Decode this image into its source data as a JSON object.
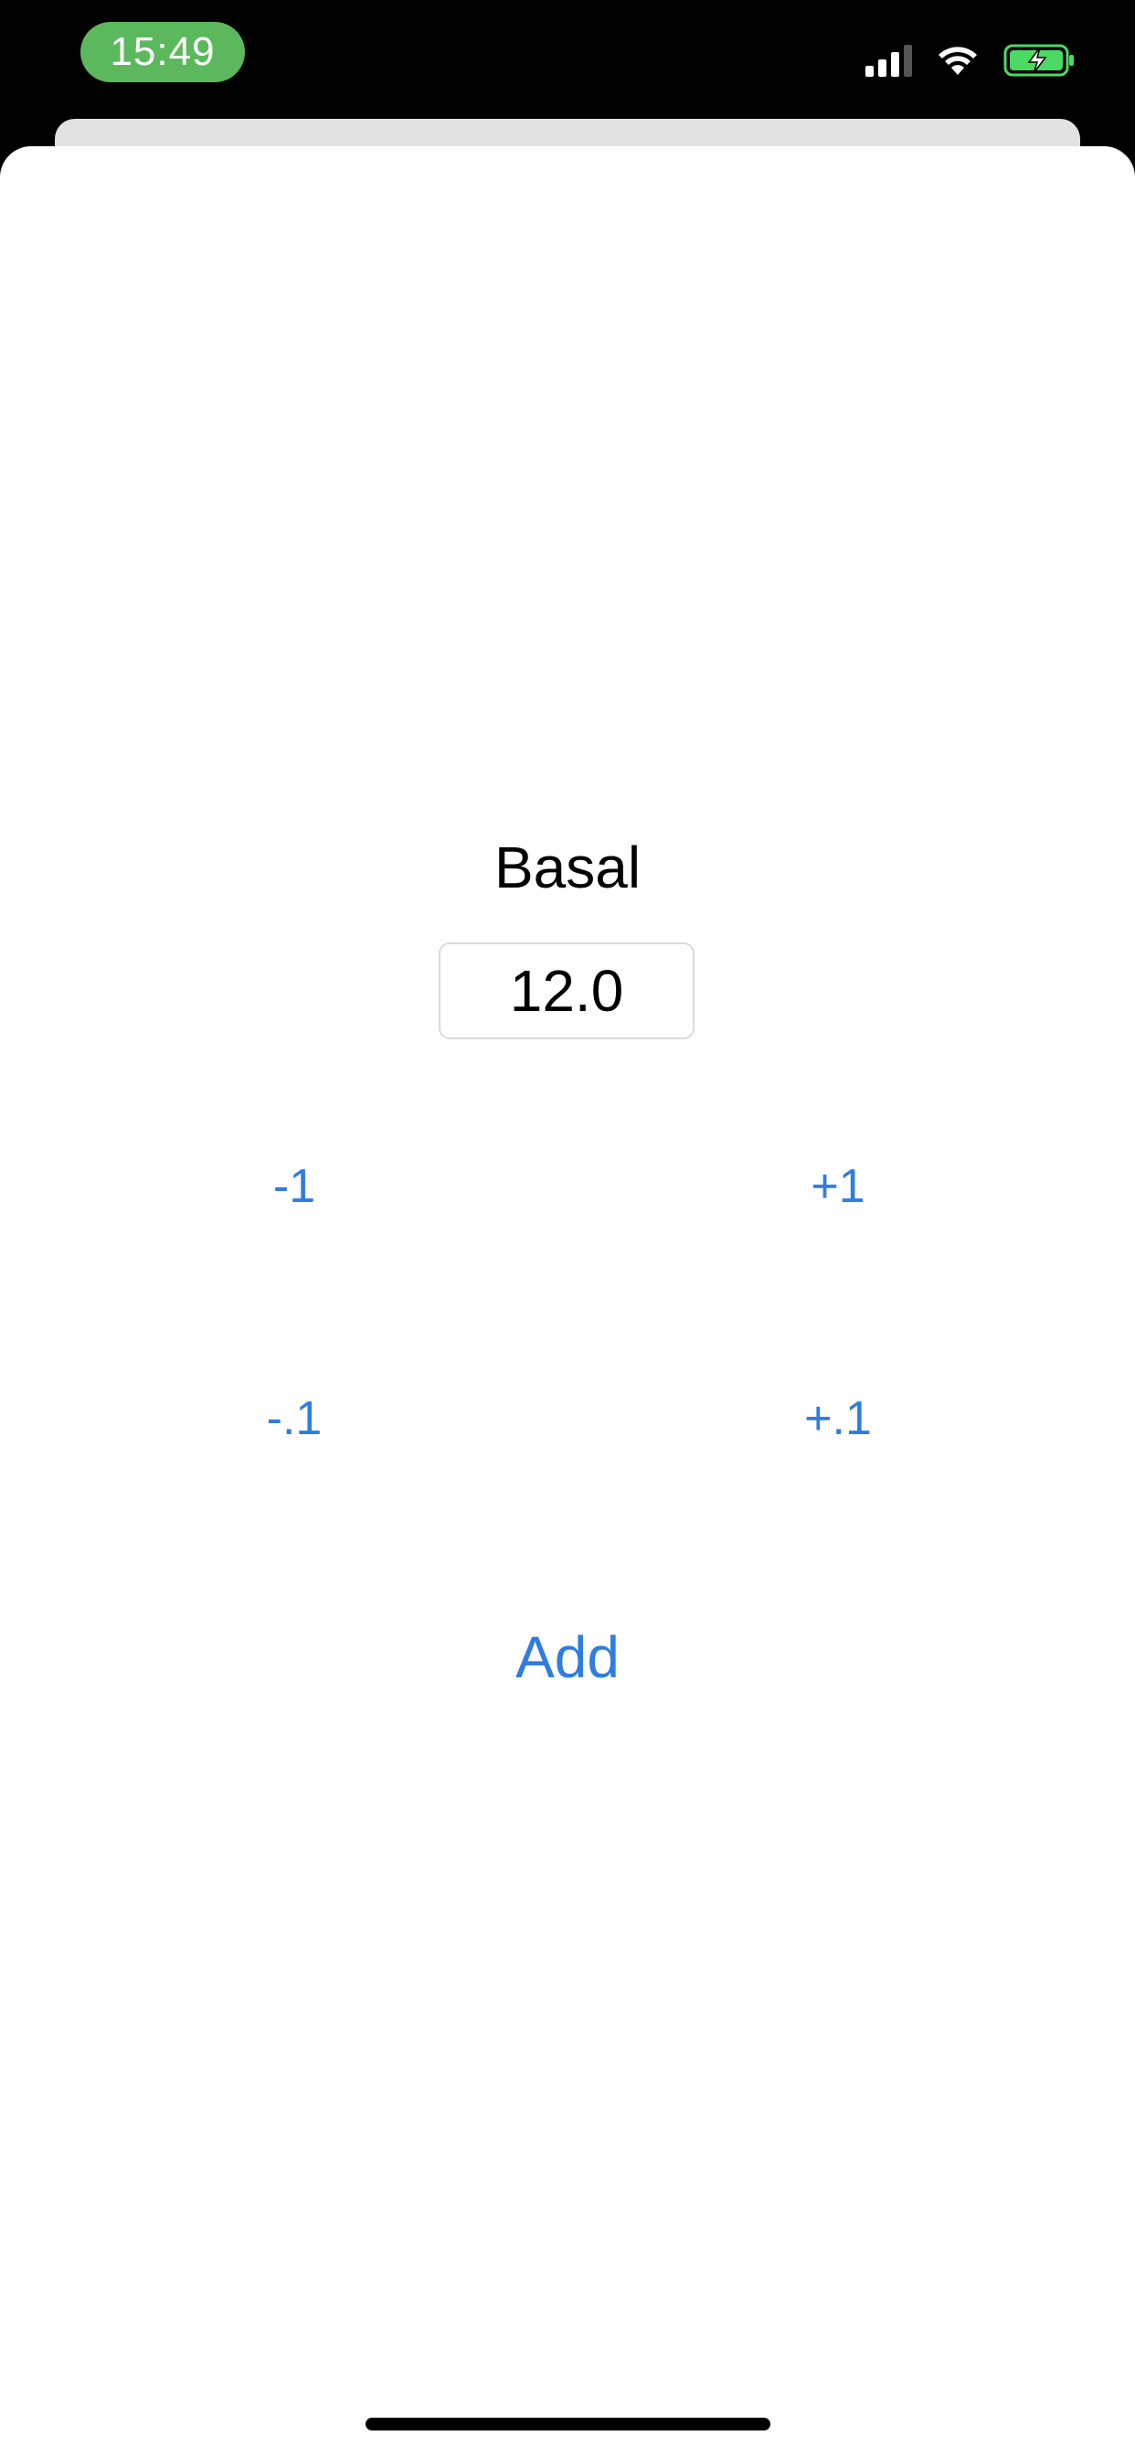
{
  "status_bar": {
    "time": "15:49",
    "time_pill_color": "#5cb85c",
    "icons": [
      "cellular-signal-icon",
      "wifi-icon",
      "battery-charging-icon"
    ],
    "battery_color": "#4cd964"
  },
  "screen": {
    "title": "Basal",
    "value": "12.0",
    "buttons": {
      "minus_one": "-1",
      "plus_one": "+1",
      "minus_tenth": "-.1",
      "plus_tenth": "+.1",
      "add": "Add"
    },
    "accent_color": "#2f7de1"
  }
}
